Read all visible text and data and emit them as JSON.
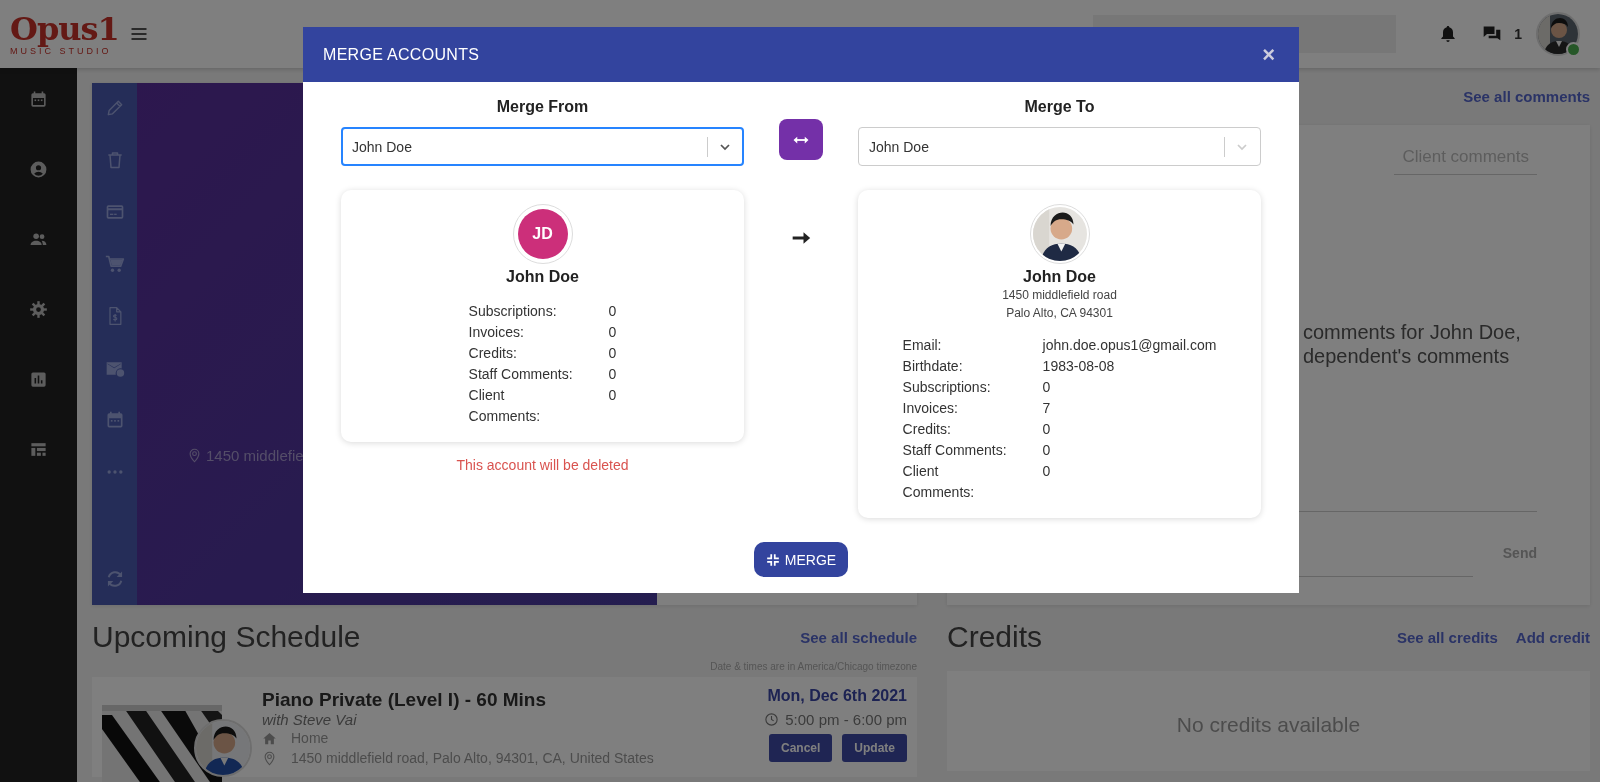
{
  "header": {
    "logo": {
      "name": "Opus1",
      "tagline": "MUSIC STUDIO"
    },
    "chat_count": "1",
    "user_online": true
  },
  "profile": {
    "address": "1450 middlefie"
  },
  "comments": {
    "link": "See all comments",
    "tab": "Client comments",
    "message_lines": [
      "comments for John Doe,",
      "dependent's comments"
    ],
    "send": "Send"
  },
  "schedule": {
    "title": "Upcoming Schedule",
    "link": "See all schedule",
    "timezone_note": "Date & times are in America/Chicago timezone",
    "events": [
      {
        "title": "Piano Private (Level I) - 60 Mins",
        "teacher": "with Steve Vai",
        "location": "Home",
        "address": "1450 middlefield road, Palo Alto, 94301, CA, United States",
        "date": "Mon, Dec 6th 2021",
        "time": "5:00 pm - 6:00 pm",
        "buttons": [
          "Cancel",
          "Update"
        ]
      }
    ]
  },
  "credits": {
    "title": "Credits",
    "links": [
      "See all credits",
      "Add credit"
    ],
    "empty_text": "No credits available"
  },
  "modal": {
    "title": "MERGE ACCOUNTS",
    "close": "×",
    "merge_button": "MERGE",
    "from": {
      "heading": "Merge From",
      "value": "John Doe",
      "focused": true,
      "avatar": {
        "kind": "initials",
        "initials": "JD"
      },
      "name": "John Doe",
      "fields": [
        {
          "label": "Subscriptions:",
          "value": "0"
        },
        {
          "label": "Invoices:",
          "value": "0"
        },
        {
          "label": "Credits:",
          "value": "0"
        },
        {
          "label": "Staff Comments:",
          "value": "0"
        },
        {
          "label": "Client Comments:",
          "value": "0"
        }
      ],
      "note": "This account will be deleted"
    },
    "to": {
      "heading": "Merge To",
      "value": "John Doe",
      "focused": false,
      "name": "John Doe",
      "address_lines": [
        "1450 middlefield road",
        "Palo Alto, CA 94301"
      ],
      "fields": [
        {
          "label": "Email:",
          "value": "john.doe.opus1@gmail.com"
        },
        {
          "label": "Birthdate:",
          "value": "1983-08-08"
        },
        {
          "label": "Subscriptions:",
          "value": "0"
        },
        {
          "label": "Invoices:",
          "value": "7"
        },
        {
          "label": "Credits:",
          "value": "0"
        },
        {
          "label": "Staff Comments:",
          "value": "0"
        },
        {
          "label": "Client Comments:",
          "value": "0"
        }
      ]
    }
  }
}
